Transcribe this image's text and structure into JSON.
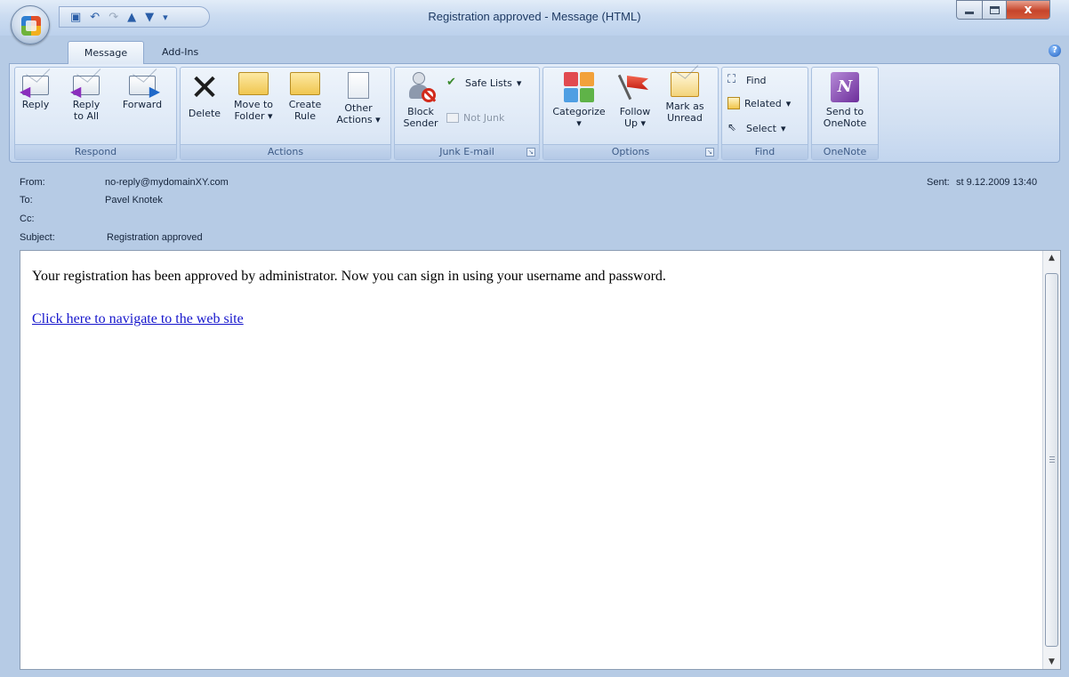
{
  "window": {
    "title": "Registration approved - Message (HTML)",
    "close_glyph": "x"
  },
  "quick_access": {
    "items": [
      "save-icon",
      "undo-icon",
      "redo-icon",
      "previous-item-icon",
      "next-item-icon",
      "customize-icon"
    ]
  },
  "tabs": [
    "Message",
    "Add-Ins"
  ],
  "help_glyph": "?",
  "ribbon": {
    "respond": {
      "label": "Respond",
      "reply": "Reply",
      "reply_all_1": "Reply",
      "reply_all_2": "to All",
      "forward": "Forward"
    },
    "actions": {
      "label": "Actions",
      "delete": "Delete",
      "move_1": "Move to",
      "move_2": "Folder",
      "create_1": "Create",
      "create_2": "Rule",
      "other_1": "Other",
      "other_2": "Actions"
    },
    "junk": {
      "label": "Junk E-mail",
      "block_1": "Block",
      "block_2": "Sender",
      "safe_lists": "Safe Lists",
      "not_junk": "Not Junk"
    },
    "options": {
      "label": "Options",
      "categorize": "Categorize",
      "follow_1": "Follow",
      "follow_2": "Up",
      "mark_1": "Mark as",
      "mark_2": "Unread"
    },
    "find": {
      "label": "Find",
      "find": "Find",
      "related": "Related",
      "select": "Select"
    },
    "onenote": {
      "label": "OneNote",
      "send_1": "Send to",
      "send_2": "OneNote",
      "glyph": "N"
    },
    "dropdown_glyph": "▾",
    "launcher_glyph": "↘"
  },
  "header": {
    "from_label": "From:",
    "from_value": "no-reply@mydomainXY.com",
    "to_label": "To:",
    "to_value": "Pavel Knotek",
    "cc_label": "Cc:",
    "cc_value": "",
    "subject_label": "Subject:",
    "subject_value": "Registration approved",
    "sent_label": "Sent:",
    "sent_value": "st 9.12.2009 13:40"
  },
  "body": {
    "text": "Your registration has been approved by administrator. Now you can sign in using your username and password.",
    "link": "Click here to navigate to the web site"
  },
  "colors": {
    "link": "#1515cc",
    "frame": "#b6cbe5",
    "close_button": "#c6452b"
  }
}
